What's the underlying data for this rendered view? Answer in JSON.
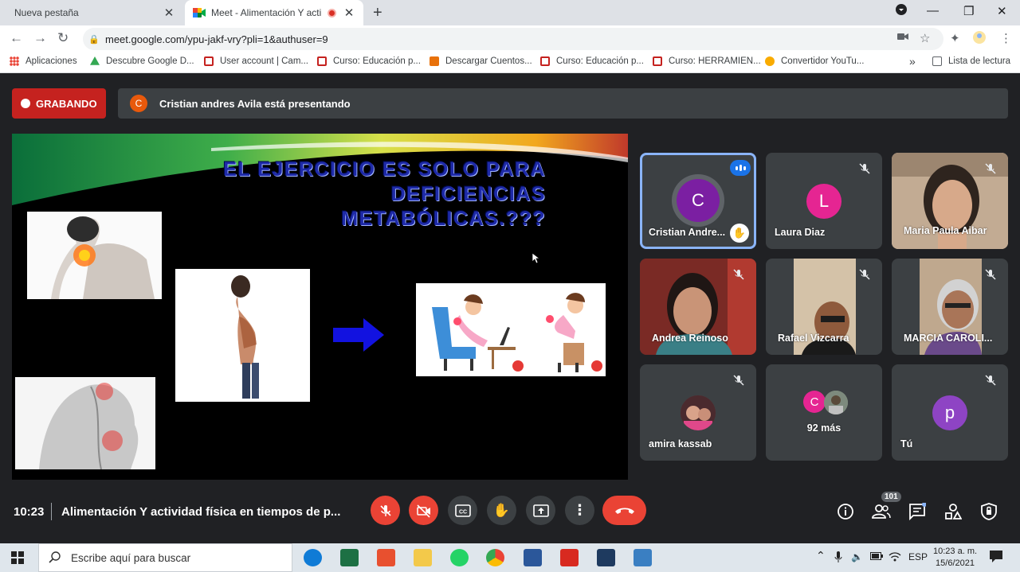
{
  "browser": {
    "tabs": [
      {
        "title": "Nueva pestaña",
        "close": "✕"
      },
      {
        "title": "Meet - Alimentación Y activi",
        "close": "✕"
      }
    ],
    "new_tab": "+",
    "url": "meet.google.com/ypu-jakf-vry?pli=1&authuser=9",
    "bookmarks": [
      {
        "label": "Aplicaciones",
        "color": "#4285f4"
      },
      {
        "label": "Descubre Google D...",
        "color": "#34a853"
      },
      {
        "label": "User account | Cam...",
        "color": "#c5221f"
      },
      {
        "label": "Curso: Educación p...",
        "color": "#c5221f"
      },
      {
        "label": "Descargar Cuentos...",
        "color": "#e8710a"
      },
      {
        "label": "Curso: Educación p...",
        "color": "#c5221f"
      },
      {
        "label": "Curso: HERRAMIEN...",
        "color": "#c5221f"
      },
      {
        "label": "Convertidor YouTu...",
        "color": "#f9ab00"
      }
    ],
    "more": "»",
    "reading_list": "Lista de lectura"
  },
  "meet": {
    "recording_label": "GRABANDO",
    "presenter_initial": "C",
    "presenting_text": "Cristian andres Avila está presentando",
    "slide": {
      "title_line1": "EL EJERCICIO ES SOLO PARA DEFICIENCIAS",
      "title_line2": "METABÓLICAS.???"
    },
    "participants": [
      {
        "name": "Cristian Andre...",
        "initial": "C",
        "color": "#7b1fa2"
      },
      {
        "name": "Laura Diaz",
        "initial": "L",
        "color": "#e52592"
      },
      {
        "name": "Maria Paula Aibar"
      },
      {
        "name": "Andrea Reinoso"
      },
      {
        "name": "Rafael Vizcarra"
      },
      {
        "name": "MARCIA CAROLI..."
      },
      {
        "name": "amira kassab"
      },
      {
        "name": "92 más",
        "initial": "C",
        "color": "#e52592"
      },
      {
        "name": "Tú",
        "initial": "p",
        "color": "#8e44c4"
      }
    ],
    "time": "10:23",
    "meeting_title": "Alimentación Y actividad física en tiempos de p...",
    "participants_count": "101"
  },
  "taskbar": {
    "search_placeholder": "Escribe aquí para buscar",
    "language": "ESP",
    "time": "10:23 a. m.",
    "date": "15/6/2021"
  }
}
